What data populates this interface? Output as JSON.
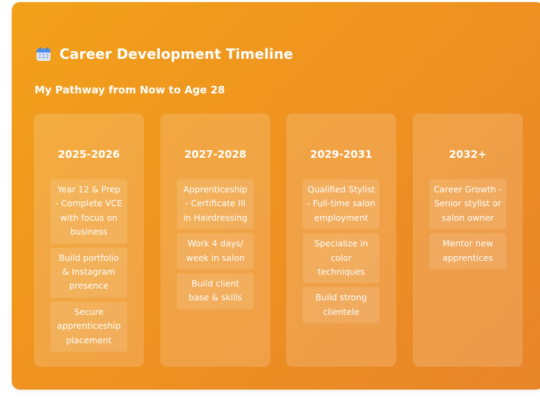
{
  "header": {
    "icon": "calendar-icon",
    "title": "Career Development Timeline",
    "subtitle": "My Pathway from Now to Age 28"
  },
  "timeline": [
    {
      "year": "2025-2026",
      "items": [
        "Year 12 & Prep - Complete VCE with focus on business",
        "Build portfolio & Instagram presence",
        "Secure apprenticeship placement"
      ]
    },
    {
      "year": "2027-2028",
      "items": [
        "Apprenticeship - Certificate III in Hairdressing",
        "Work 4 days/ week in salon",
        "Build client base & skills"
      ]
    },
    {
      "year": "2029-2031",
      "items": [
        "Qualified Stylist - Full-time salon employment",
        "Specialize in color techniques",
        "Build strong clientele"
      ]
    },
    {
      "year": "2032+",
      "items": [
        "Career Growth - Senior stylist or salon owner",
        "Mentor new apprentices"
      ]
    }
  ],
  "colors": {
    "background_start": "#f2a11a",
    "background_end": "#e8852a",
    "text": "#ffffff"
  }
}
